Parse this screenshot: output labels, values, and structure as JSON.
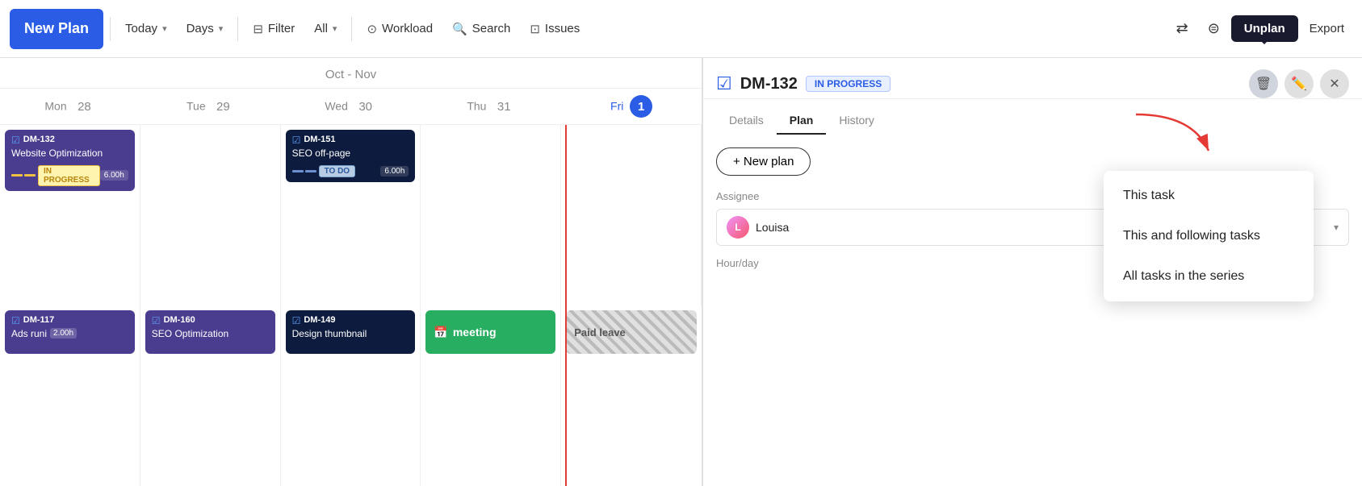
{
  "toolbar": {
    "new_plan_label": "New Plan",
    "today_label": "Today",
    "days_label": "Days",
    "filter_label": "Filter",
    "all_label": "All",
    "workload_label": "Workload",
    "search_label": "Search",
    "issues_label": "Issues",
    "export_label": "Export",
    "unplan_tooltip": "Unplan"
  },
  "calendar": {
    "month_header": "Oct - Nov",
    "days": [
      {
        "label": "Mon",
        "num": "28",
        "today": false
      },
      {
        "label": "Tue",
        "num": "29",
        "today": false
      },
      {
        "label": "Wed",
        "num": "30",
        "today": false
      },
      {
        "label": "Thu",
        "num": "31",
        "today": false
      },
      {
        "label": "Fri",
        "num": "1",
        "today": true
      }
    ],
    "row1": [
      {
        "id": "DM-132",
        "title": "Website Optimization",
        "badge": "IN PROGRESS",
        "hours": "6.00h",
        "color": "purple"
      },
      {
        "id": "",
        "title": "",
        "badge": "",
        "hours": "",
        "color": "empty"
      },
      {
        "id": "DM-151",
        "title": "SEO off-page",
        "badge": "TO DO",
        "hours": "6.00h",
        "color": "dark-blue"
      },
      {
        "id": "",
        "title": "",
        "badge": "",
        "hours": "",
        "color": "empty"
      },
      {
        "id": "",
        "title": "",
        "badge": "",
        "hours": "",
        "color": "empty"
      }
    ],
    "row2": [
      {
        "id": "DM-117",
        "title": "Ads runi",
        "hours_inline": "2.00h",
        "color": "purple-small"
      },
      {
        "id": "DM-160",
        "title": "SEO Optimization",
        "color": "purple-small"
      },
      {
        "id": "DM-149",
        "title": "Design thumbnail",
        "color": "purple-small"
      },
      {
        "type": "meeting",
        "title": "meeting"
      },
      {
        "type": "paid-leave",
        "title": "Paid leave"
      }
    ]
  },
  "detail": {
    "task_id": "DM-132",
    "status": "IN PROGRESS",
    "tabs": [
      "Details",
      "Plan",
      "History"
    ],
    "active_tab": "Plan",
    "new_plan_label": "+ New plan",
    "assignee_label": "Assignee",
    "assignee_name": "Louisa",
    "hourday_label": "Hour/day"
  },
  "dropdown": {
    "items": [
      "This task",
      "This and following tasks",
      "All tasks in the series"
    ]
  }
}
